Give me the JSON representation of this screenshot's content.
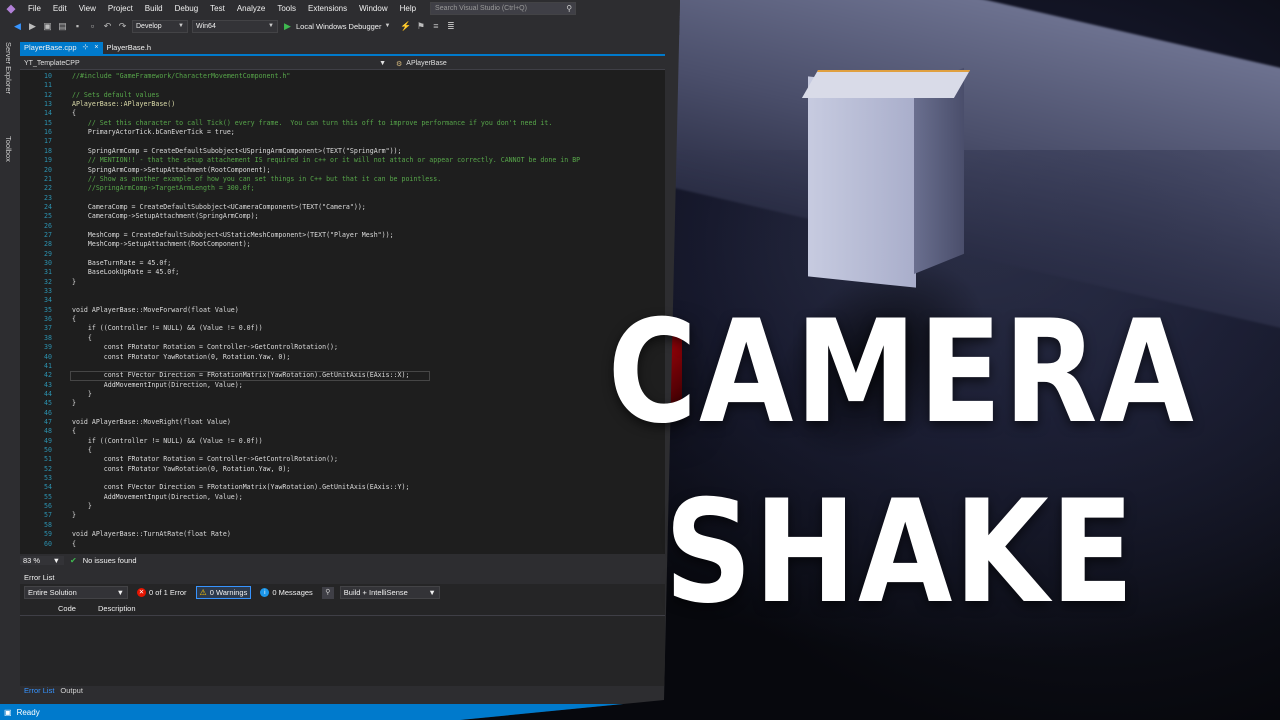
{
  "colors": {
    "accent": "#007acc",
    "editor_bg": "#1e1e1e",
    "comment": "#57a64a",
    "line_number": "#2b91af",
    "red_cube": "#c00c14"
  },
  "menubar": {
    "items": [
      "File",
      "Edit",
      "View",
      "Project",
      "Build",
      "Debug",
      "Test",
      "Analyze",
      "Tools",
      "Extensions",
      "Window",
      "Help"
    ],
    "search_placeholder": "Search Visual Studio (Ctrl+Q)"
  },
  "toolbar": {
    "configuration": "Develop",
    "platform": "Win64",
    "debugger": "Local Windows Debugger"
  },
  "side_tabs": [
    "Server Explorer",
    "Toolbox"
  ],
  "tabs": [
    {
      "label": "PlayerBase.cpp",
      "pin": "⊹",
      "close": "×"
    },
    {
      "label": "PlayerBase.h"
    }
  ],
  "navbar": {
    "project": "YT_TemplateCPP",
    "scope": "APlayerBase"
  },
  "code_lines": [
    {
      "n": "10",
      "t": "//#include \"GameFramework/CharacterMovementComponent.h\"",
      "c": "comment"
    },
    {
      "n": "11",
      "t": "",
      "c": ""
    },
    {
      "n": "12",
      "t": "// Sets default values",
      "c": "comment"
    },
    {
      "n": "13",
      "t": "APlayerBase::APlayerBase()",
      "c": "fn"
    },
    {
      "n": "14",
      "t": "{",
      "c": ""
    },
    {
      "n": "15",
      "t": "    // Set this character to call Tick() every frame.  You can turn this off to improve performance if you don't need it.",
      "c": "comment"
    },
    {
      "n": "16",
      "t": "    PrimaryActorTick.bCanEverTick = true;",
      "c": ""
    },
    {
      "n": "17",
      "t": "",
      "c": ""
    },
    {
      "n": "18",
      "t": "    SpringArmComp = CreateDefaultSubobject<USpringArmComponent>(TEXT(\"SpringArm\"));",
      "c": ""
    },
    {
      "n": "19",
      "t": "    // MENTION!! - that the setup attachement IS required in c++ or it will not attach or appear correctly. CANNOT be done in BP",
      "c": "comment"
    },
    {
      "n": "20",
      "t": "    SpringArmComp->SetupAttachment(RootComponent);",
      "c": ""
    },
    {
      "n": "21",
      "t": "    // Show as another example of how you can set things in C++ but that it can be pointless.",
      "c": "comment"
    },
    {
      "n": "22",
      "t": "    //SpringArmComp->TargetArmLength = 300.0f;",
      "c": "comment"
    },
    {
      "n": "23",
      "t": "",
      "c": ""
    },
    {
      "n": "24",
      "t": "    CameraComp = CreateDefaultSubobject<UCameraComponent>(TEXT(\"Camera\"));",
      "c": ""
    },
    {
      "n": "25",
      "t": "    CameraComp->SetupAttachment(SpringArmComp);",
      "c": ""
    },
    {
      "n": "26",
      "t": "",
      "c": ""
    },
    {
      "n": "27",
      "t": "    MeshComp = CreateDefaultSubobject<UStaticMeshComponent>(TEXT(\"Player Mesh\"));",
      "c": ""
    },
    {
      "n": "28",
      "t": "    MeshComp->SetupAttachment(RootComponent);",
      "c": ""
    },
    {
      "n": "29",
      "t": "",
      "c": ""
    },
    {
      "n": "30",
      "t": "    BaseTurnRate = 45.0f;",
      "c": ""
    },
    {
      "n": "31",
      "t": "    BaseLookUpRate = 45.0f;",
      "c": ""
    },
    {
      "n": "32",
      "t": "}",
      "c": ""
    },
    {
      "n": "33",
      "t": "",
      "c": ""
    },
    {
      "n": "34",
      "t": "",
      "c": ""
    },
    {
      "n": "35",
      "t": "void APlayerBase::MoveForward(float Value)",
      "c": ""
    },
    {
      "n": "36",
      "t": "{",
      "c": ""
    },
    {
      "n": "37",
      "t": "    if ((Controller != NULL) && (Value != 0.0f))",
      "c": ""
    },
    {
      "n": "38",
      "t": "    {",
      "c": ""
    },
    {
      "n": "39",
      "t": "        const FRotator Rotation = Controller->GetControlRotation();",
      "c": ""
    },
    {
      "n": "40",
      "t": "        const FRotator YawRotation(0, Rotation.Yaw, 0);",
      "c": ""
    },
    {
      "n": "41",
      "t": "",
      "c": ""
    },
    {
      "n": "42",
      "t": "        const FVector Direction = FRotationMatrix(YawRotation).GetUnitAxis(EAxis::X);",
      "c": "",
      "hl": true
    },
    {
      "n": "43",
      "t": "        AddMovementInput(Direction, Value);",
      "c": ""
    },
    {
      "n": "44",
      "t": "    }",
      "c": ""
    },
    {
      "n": "45",
      "t": "}",
      "c": ""
    },
    {
      "n": "46",
      "t": "",
      "c": ""
    },
    {
      "n": "47",
      "t": "void APlayerBase::MoveRight(float Value)",
      "c": ""
    },
    {
      "n": "48",
      "t": "{",
      "c": ""
    },
    {
      "n": "49",
      "t": "    if ((Controller != NULL) && (Value != 0.0f))",
      "c": ""
    },
    {
      "n": "50",
      "t": "    {",
      "c": ""
    },
    {
      "n": "51",
      "t": "        const FRotator Rotation = Controller->GetControlRotation();",
      "c": ""
    },
    {
      "n": "52",
      "t": "        const FRotator YawRotation(0, Rotation.Yaw, 0);",
      "c": ""
    },
    {
      "n": "53",
      "t": "",
      "c": ""
    },
    {
      "n": "54",
      "t": "        const FVector Direction = FRotationMatrix(YawRotation).GetUnitAxis(EAxis::Y);",
      "c": ""
    },
    {
      "n": "55",
      "t": "        AddMovementInput(Direction, Value);",
      "c": ""
    },
    {
      "n": "56",
      "t": "    }",
      "c": ""
    },
    {
      "n": "57",
      "t": "}",
      "c": ""
    },
    {
      "n": "58",
      "t": "",
      "c": ""
    },
    {
      "n": "59",
      "t": "void APlayerBase::TurnAtRate(float Rate)",
      "c": ""
    },
    {
      "n": "60",
      "t": "{",
      "c": ""
    }
  ],
  "status_strip": {
    "zoom": "83 %",
    "issues": "No issues found"
  },
  "error_list": {
    "title": "Error List",
    "scope": "Entire Solution",
    "errors": "0 of 1 Error",
    "warnings": "0 Warnings",
    "messages": "0 Messages",
    "source": "Build + IntelliSense",
    "col_code": "Code",
    "col_description": "Description"
  },
  "bottom_tabs": [
    "Error List",
    "Output"
  ],
  "statusbar": {
    "text": "Ready"
  },
  "overlay_title": {
    "line1": "CAMERA",
    "line2": "SHAKE"
  }
}
